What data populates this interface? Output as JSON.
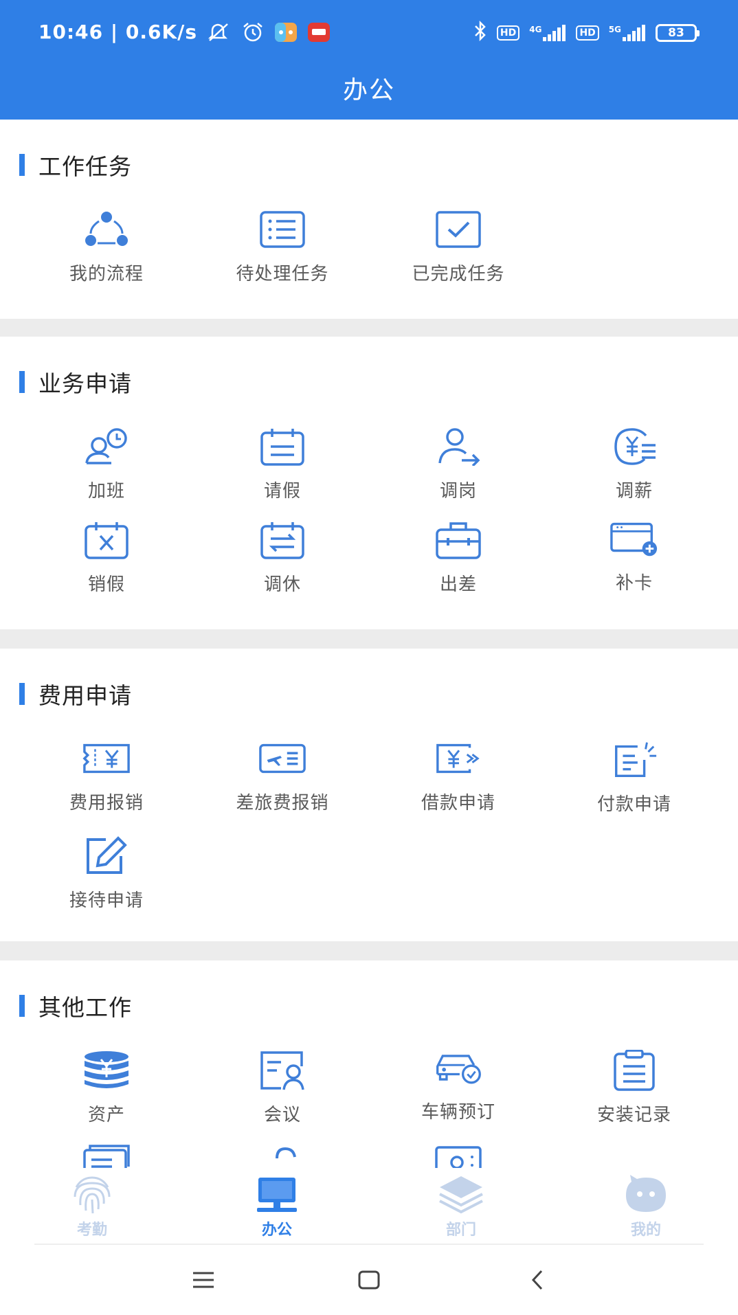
{
  "status": {
    "time_speed": "10:46 | 0.6K/s",
    "hd1": "HD",
    "net1": "4G",
    "hd2": "HD",
    "net2": "5G",
    "battery": "83"
  },
  "header": {
    "title": "办公"
  },
  "sections": {
    "work_tasks": {
      "title": "工作任务",
      "items": [
        {
          "label": "我的流程",
          "icon": "workflow-icon"
        },
        {
          "label": "待处理任务",
          "icon": "list-icon"
        },
        {
          "label": "已完成任务",
          "icon": "checkbox-icon"
        }
      ]
    },
    "business": {
      "title": "业务申请",
      "items": [
        {
          "label": "加班",
          "icon": "overtime-icon"
        },
        {
          "label": "请假",
          "icon": "calendar-icon"
        },
        {
          "label": "调岗",
          "icon": "user-transfer-icon"
        },
        {
          "label": "调薪",
          "icon": "salary-icon"
        },
        {
          "label": "销假",
          "icon": "calendar-cancel-icon"
        },
        {
          "label": "调休",
          "icon": "calendar-swap-icon"
        },
        {
          "label": "出差",
          "icon": "briefcase-icon"
        },
        {
          "label": "补卡",
          "icon": "card-add-icon"
        }
      ]
    },
    "expense": {
      "title": "费用申请",
      "items": [
        {
          "label": "费用报销",
          "icon": "receipt-icon"
        },
        {
          "label": "差旅费报销",
          "icon": "flight-ticket-icon"
        },
        {
          "label": "借款申请",
          "icon": "loan-icon"
        },
        {
          "label": "付款申请",
          "icon": "payment-doc-icon"
        },
        {
          "label": "接待申请",
          "icon": "edit-icon"
        }
      ]
    },
    "other": {
      "title": "其他工作",
      "items": [
        {
          "label": "资产",
          "icon": "coins-icon"
        },
        {
          "label": "会议",
          "icon": "meeting-icon"
        },
        {
          "label": "车辆预订",
          "icon": "car-icon"
        },
        {
          "label": "安装记录",
          "icon": "clipboard-icon"
        }
      ]
    }
  },
  "tabbar": {
    "active_color": "#2f7fe6",
    "inactive_color": "#b5c9e6",
    "tabs": [
      {
        "label": "考勤",
        "icon": "fingerprint-icon",
        "active": false
      },
      {
        "label": "办公",
        "icon": "computer-icon",
        "active": true
      },
      {
        "label": "部门",
        "icon": "layers-icon",
        "active": false
      },
      {
        "label": "我的",
        "icon": "smiley-icon",
        "active": false
      }
    ]
  },
  "colors": {
    "accent": "#2f7fe6",
    "icon": "#3f7fd9"
  }
}
